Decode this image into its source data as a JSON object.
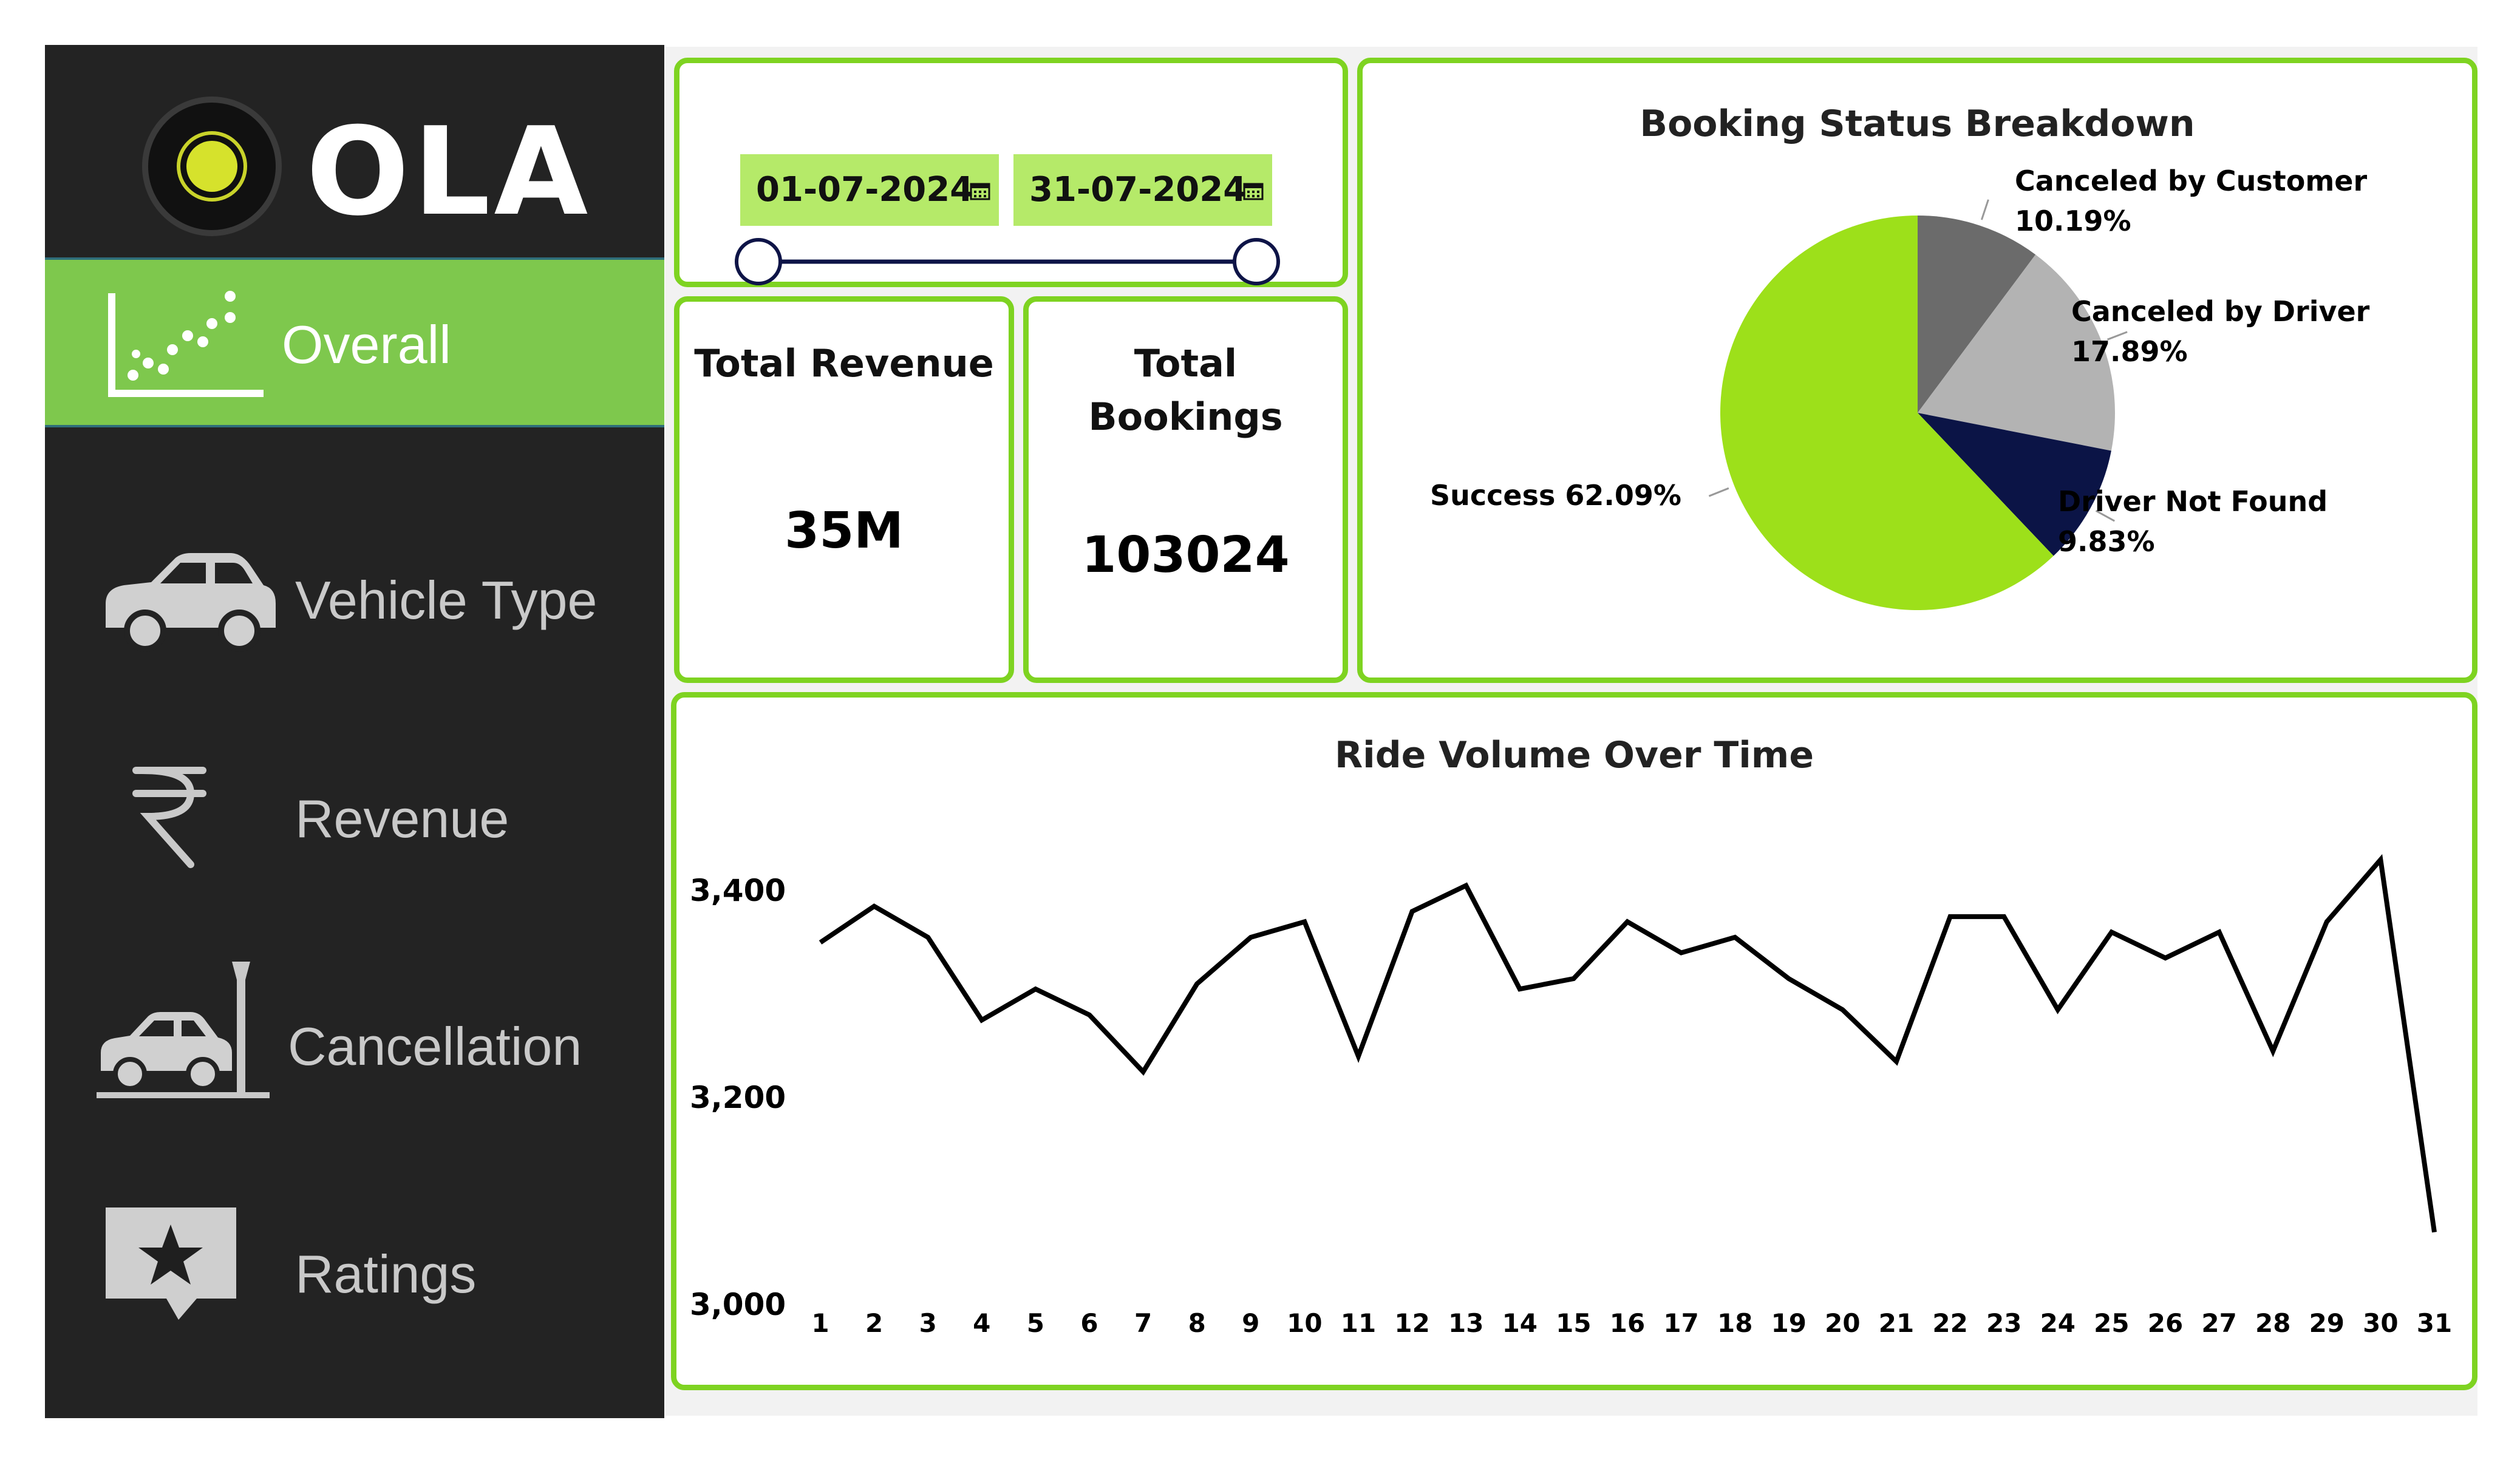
{
  "app": {
    "logo_text": "OLA"
  },
  "sidebar": {
    "items": [
      {
        "label": "Overall",
        "icon": "scatter-chart-icon",
        "active": true
      },
      {
        "label": "Vehicle Type",
        "icon": "car-icon",
        "active": false
      },
      {
        "label": "Revenue",
        "icon": "rupee-icon",
        "active": false
      },
      {
        "label": "Cancellation",
        "icon": "car-crash-icon",
        "active": false
      },
      {
        "label": "Ratings",
        "icon": "star-review-icon",
        "active": false
      }
    ]
  },
  "date_filter": {
    "start": "01-07-2024",
    "end": "31-07-2024",
    "range_fraction": [
      0,
      1
    ]
  },
  "kpis": {
    "revenue": {
      "title": "Total Revenue",
      "value": "35M"
    },
    "bookings": {
      "title_line1": "Total",
      "title_line2": "Bookings",
      "value": "103024"
    }
  },
  "colors": {
    "accent": "#7ed321",
    "sidebar_bg": "#232323",
    "active_nav": "#7ec84d"
  },
  "chart_data": [
    {
      "type": "pie",
      "title": "Booking Status Breakdown",
      "slices": [
        {
          "label": "Canceled by Customer",
          "value": 10.19,
          "display": "10.19%",
          "color": "#6b6b6b"
        },
        {
          "label": "Canceled by Driver",
          "value": 17.89,
          "display": "17.89%",
          "color": "#b3b3b3"
        },
        {
          "label": "Driver Not Found",
          "value": 9.83,
          "display": "9.83%",
          "color": "#0b1446"
        },
        {
          "label": "Success",
          "value": 62.09,
          "display": "62.09%",
          "color": "#9de01a"
        }
      ]
    },
    {
      "type": "line",
      "title": "Ride Volume Over Time",
      "x": [
        1,
        2,
        3,
        4,
        5,
        6,
        7,
        8,
        9,
        10,
        11,
        12,
        13,
        14,
        15,
        16,
        17,
        18,
        19,
        20,
        21,
        22,
        23,
        24,
        25,
        26,
        27,
        28,
        29,
        30,
        31
      ],
      "series": [
        {
          "values": [
            3350,
            3385,
            3355,
            3275,
            3305,
            3280,
            3225,
            3310,
            3355,
            3370,
            3240,
            3380,
            3405,
            3305,
            3315,
            3370,
            3340,
            3355,
            3315,
            3285,
            3235,
            3375,
            3375,
            3285,
            3360,
            3335,
            3360,
            3245,
            3370,
            3430,
            3070
          ]
        }
      ],
      "ylim": [
        3000,
        3450
      ],
      "yticks": [
        3000,
        3200,
        3400
      ],
      "ytick_labels": [
        "3,000",
        "3,200",
        "3,400"
      ],
      "grid": false,
      "color": "#000000"
    }
  ]
}
